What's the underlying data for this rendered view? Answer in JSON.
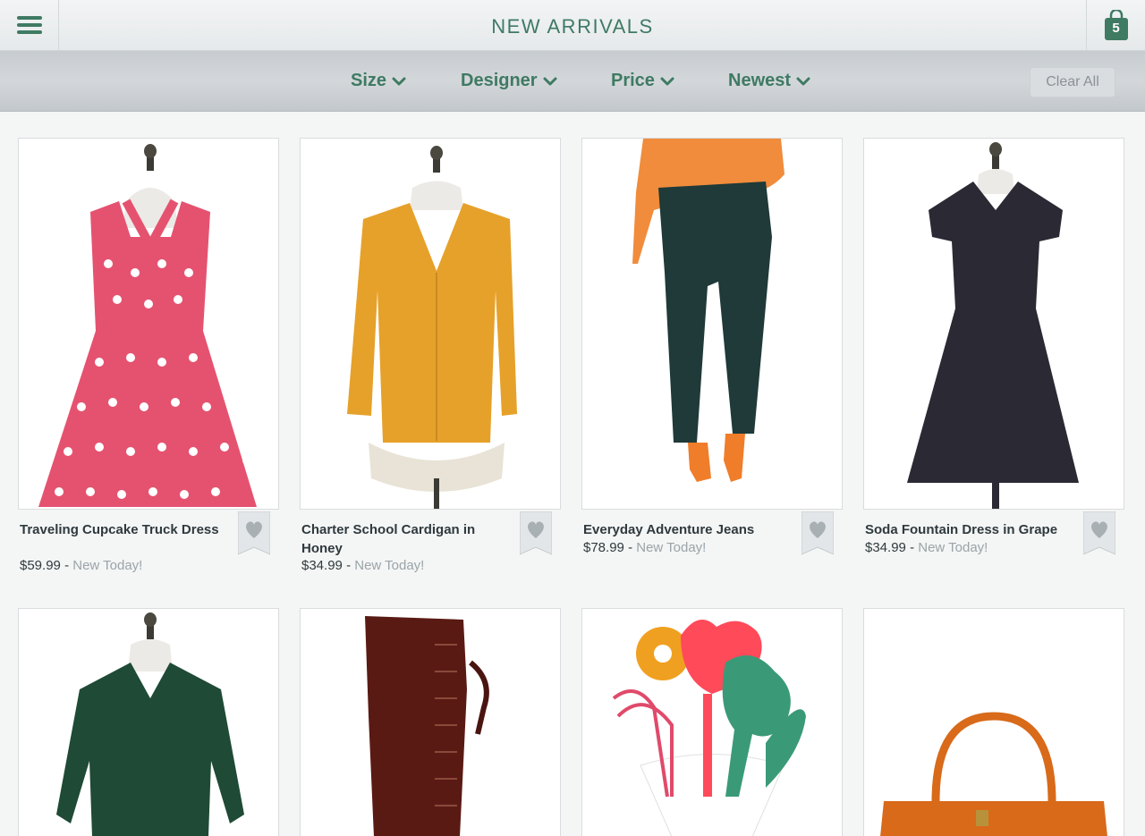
{
  "header": {
    "title": "NEW ARRIVALS",
    "cart_count": "5"
  },
  "filters": {
    "items": [
      "Size",
      "Designer",
      "Price",
      "Newest"
    ],
    "clear_label": "Clear All"
  },
  "colors": {
    "brand_green": "#3f7a63",
    "text_dark": "#2f3a3e",
    "muted": "#9aa4a8"
  },
  "products": [
    {
      "name": "Traveling Cupcake Truck Dress",
      "price": "$59.99",
      "tag": "New Today!",
      "image": "pink-polka-dot-dress"
    },
    {
      "name": "Charter School Cardigan in Honey",
      "price": "$34.99",
      "tag": "New Today!",
      "image": "mustard-cardigan"
    },
    {
      "name": "Everyday Adventure Jeans",
      "price": "$78.99",
      "tag": "New Today!",
      "image": "dark-green-jeans"
    },
    {
      "name": "Soda Fountain Dress in Grape",
      "price": "$34.99",
      "tag": "New Today!",
      "image": "black-dress"
    },
    {
      "image": "green-blouse"
    },
    {
      "image": "brown-lace-up-boot"
    },
    {
      "image": "kitchen-utensils"
    },
    {
      "image": "orange-handbag"
    }
  ]
}
